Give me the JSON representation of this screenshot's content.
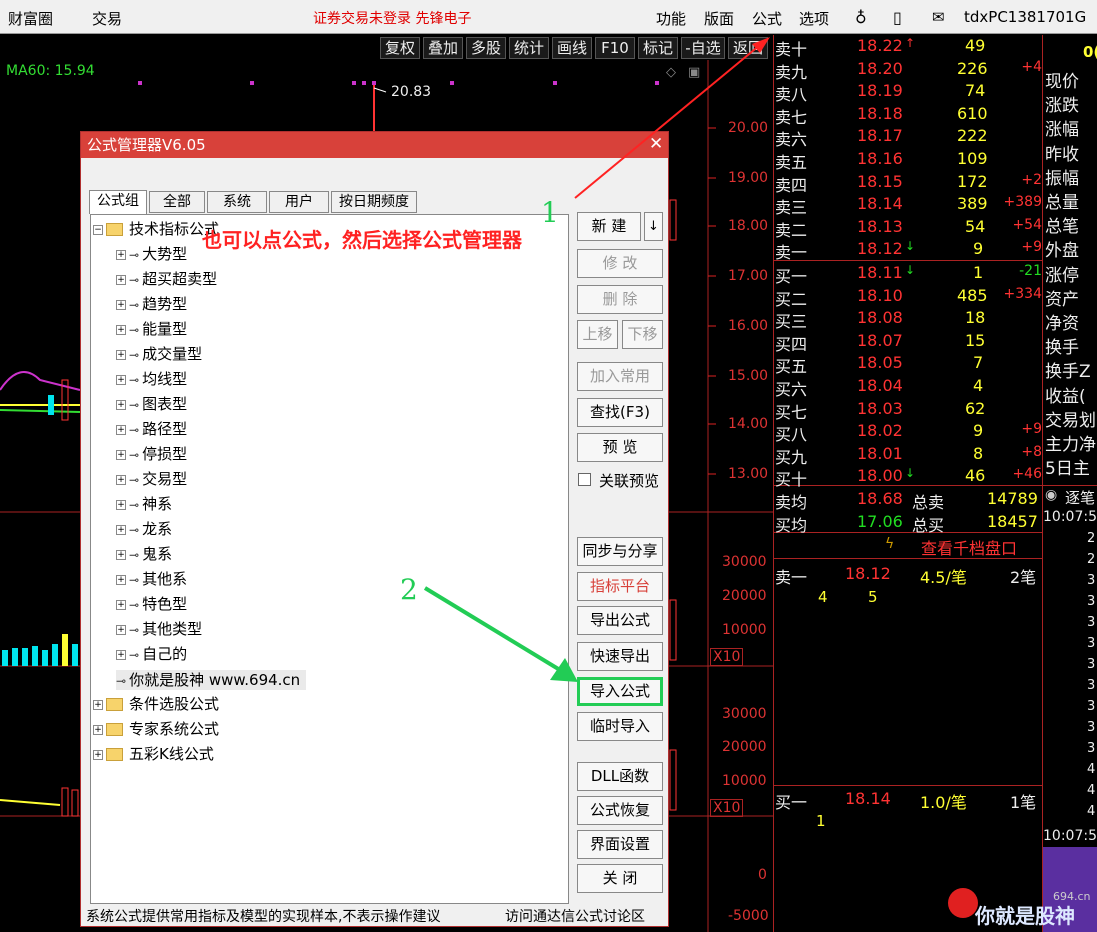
{
  "menubar": {
    "app_name": "财富圈",
    "trade": "交易",
    "status": "证券交易未登录  先锋电子",
    "func": "功能",
    "layout": "版面",
    "formula": "公式",
    "options": "选项",
    "user": "tdxPC1381701G"
  },
  "toolbar": [
    "复权",
    "叠加",
    "多股",
    "统计",
    "画线",
    "F10",
    "标记",
    "-自选",
    "返回"
  ],
  "chart": {
    "ma60": "MA60: 15.94",
    "peak": "20.83",
    "price_ticks": [
      "20.00",
      "19.00",
      "18.00",
      "17.00",
      "16.00",
      "15.00",
      "14.00",
      "13.00"
    ],
    "vol_ticks": [
      "30000",
      "20000",
      "10000",
      "X10"
    ],
    "vol2_ticks": [
      "30000",
      "20000",
      "10000",
      "X10"
    ],
    "bottom_ticks": [
      "0",
      "-5000"
    ]
  },
  "orderbook": {
    "sells": [
      {
        "label": "卖十",
        "price": "18.22",
        "arrow": "↑",
        "vol": "49",
        "chg": ""
      },
      {
        "label": "卖九",
        "price": "18.20",
        "arrow": "",
        "vol": "226",
        "chg": "+4"
      },
      {
        "label": "卖八",
        "price": "18.19",
        "arrow": "",
        "vol": "74",
        "chg": ""
      },
      {
        "label": "卖七",
        "price": "18.18",
        "arrow": "",
        "vol": "610",
        "chg": ""
      },
      {
        "label": "卖六",
        "price": "18.17",
        "arrow": "",
        "vol": "222",
        "chg": ""
      },
      {
        "label": "卖五",
        "price": "18.16",
        "arrow": "",
        "vol": "109",
        "chg": ""
      },
      {
        "label": "卖四",
        "price": "18.15",
        "arrow": "",
        "vol": "172",
        "chg": "+2"
      },
      {
        "label": "卖三",
        "price": "18.14",
        "arrow": "",
        "vol": "389",
        "chg": "+389"
      },
      {
        "label": "卖二",
        "price": "18.13",
        "arrow": "",
        "vol": "54",
        "chg": "+54"
      },
      {
        "label": "卖一",
        "price": "18.12",
        "arrow": "↓",
        "vol": "9",
        "chg": "+9"
      }
    ],
    "buys": [
      {
        "label": "买一",
        "price": "18.11",
        "arrow": "↓",
        "vol": "1",
        "chg": "-21"
      },
      {
        "label": "买二",
        "price": "18.10",
        "arrow": "",
        "vol": "485",
        "chg": "+334"
      },
      {
        "label": "买三",
        "price": "18.08",
        "arrow": "",
        "vol": "18",
        "chg": ""
      },
      {
        "label": "买四",
        "price": "18.07",
        "arrow": "",
        "vol": "15",
        "chg": ""
      },
      {
        "label": "买五",
        "price": "18.05",
        "arrow": "",
        "vol": "7",
        "chg": ""
      },
      {
        "label": "买六",
        "price": "18.04",
        "arrow": "",
        "vol": "4",
        "chg": ""
      },
      {
        "label": "买七",
        "price": "18.03",
        "arrow": "",
        "vol": "62",
        "chg": ""
      },
      {
        "label": "买八",
        "price": "18.02",
        "arrow": "",
        "vol": "9",
        "chg": "+9"
      },
      {
        "label": "买九",
        "price": "18.01",
        "arrow": "",
        "vol": "8",
        "chg": "+8"
      },
      {
        "label": "买十",
        "price": "18.00",
        "arrow": "↓",
        "vol": "46",
        "chg": "+46"
      }
    ],
    "avg_sell": {
      "label": "卖均",
      "price": "18.68",
      "total_label": "总卖",
      "total": "14789"
    },
    "avg_buy": {
      "label": "买均",
      "price": "17.06",
      "total_label": "总买",
      "total": "18457"
    },
    "view_depth": "查看千档盘口",
    "q1": {
      "label": "卖一",
      "price": "18.12",
      "ratio": "4.5/笔",
      "count": "2笔",
      "a": "4",
      "b": "5"
    },
    "q2": {
      "label": "买一",
      "price": "18.14",
      "ratio": "1.0/笔",
      "count": "1笔",
      "a": "1"
    }
  },
  "side": {
    "top": "0(",
    "labels": [
      "现价",
      "涨跌",
      "涨幅",
      "昨收",
      "振幅",
      "总量",
      "总笔",
      "外盘",
      "涨停",
      "资产",
      "净资",
      "换手",
      "换手Z",
      "收益(",
      "交易划",
      "主力净",
      "5日主"
    ],
    "tick_title": "逐笔",
    "time1": "10:07:5",
    "time2": "10:07:5",
    "digits": [
      "2",
      "2",
      "3",
      "3",
      "3",
      "3",
      "3",
      "3",
      "3",
      "3",
      "3",
      "4",
      "4",
      "4"
    ]
  },
  "dialog": {
    "title": "公式管理器V6.05",
    "tabs": [
      "公式组",
      "全部",
      "系统",
      "用户",
      "按日期频度"
    ],
    "root": "技术指标公式",
    "items": [
      "大势型",
      "超买超卖型",
      "趋势型",
      "能量型",
      "成交量型",
      "均线型",
      "图表型",
      "路径型",
      "停损型",
      "交易型",
      "神系",
      "龙系",
      "鬼系",
      "其他系",
      "特色型",
      "其他类型",
      "自己的"
    ],
    "custom_item": "你就是股神 www.694.cn",
    "others": [
      "条件选股公式",
      "专家系统公式",
      "五彩K线公式"
    ],
    "buttons": {
      "new": "新 建",
      "modify": "修 改",
      "delete": "删 除",
      "up": "上移",
      "down": "下移",
      "add_common": "加入常用",
      "find": "查找(F3)",
      "preview": "预 览",
      "link_preview": "关联预览",
      "sync": "同步与分享",
      "platform": "指标平台",
      "export": "导出公式",
      "quick_export": "快速导出",
      "import": "导入公式",
      "temp_import": "临时导入",
      "dll": "DLL函数",
      "restore": "公式恢复",
      "ui": "界面设置",
      "close": "关 闭"
    },
    "footer": "系统公式提供常用指标及模型的实现样本,不表示操作建议",
    "forum": "访问通达信公式讨论区"
  },
  "annotations": {
    "n1": "1",
    "n2": "2",
    "hint": "也可以点公式，然后选择公式管理器"
  },
  "watermark": {
    "text": "你就是股神",
    "url": "694.cn"
  },
  "colors": {
    "dialog_title": "#d8413a",
    "highlight": "#22cc55",
    "annotation": "#ff2222"
  }
}
